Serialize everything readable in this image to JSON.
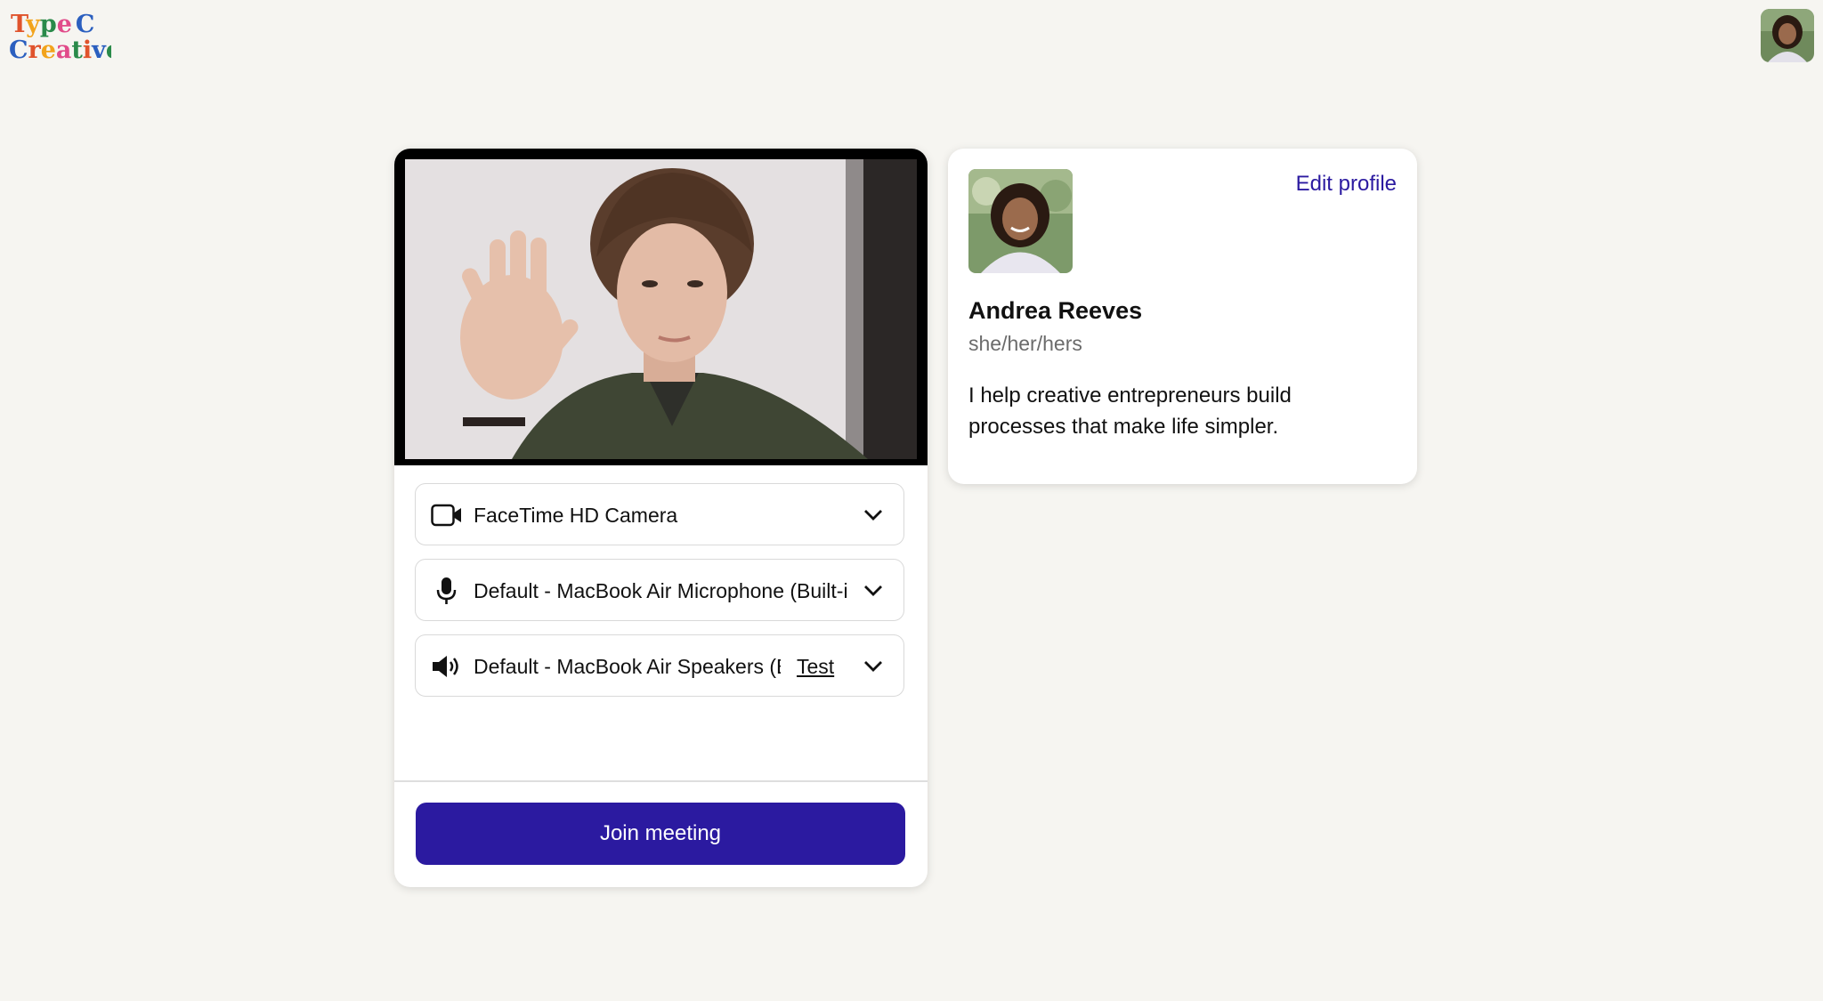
{
  "brand": {
    "logo_line1": "Type C",
    "logo_line2": "Creative"
  },
  "devices": {
    "camera": {
      "value": "FaceTime HD Camera",
      "icon": "video-camera-icon"
    },
    "microphone": {
      "value": "Default - MacBook Air Microphone (Built-in)",
      "icon": "microphone-icon"
    },
    "speaker": {
      "value": "Default - MacBook Air Speakers (Built-in)",
      "icon": "speaker-icon",
      "test_label": "Test"
    }
  },
  "join_label": "Join meeting",
  "profile": {
    "edit_label": "Edit profile",
    "name": "Andrea Reeves",
    "pronouns": "she/her/hers",
    "bio": "I help creative entrepreneurs build processes that make life simpler."
  },
  "colors": {
    "accent": "#2b1aa0",
    "background": "#f6f5f1"
  }
}
